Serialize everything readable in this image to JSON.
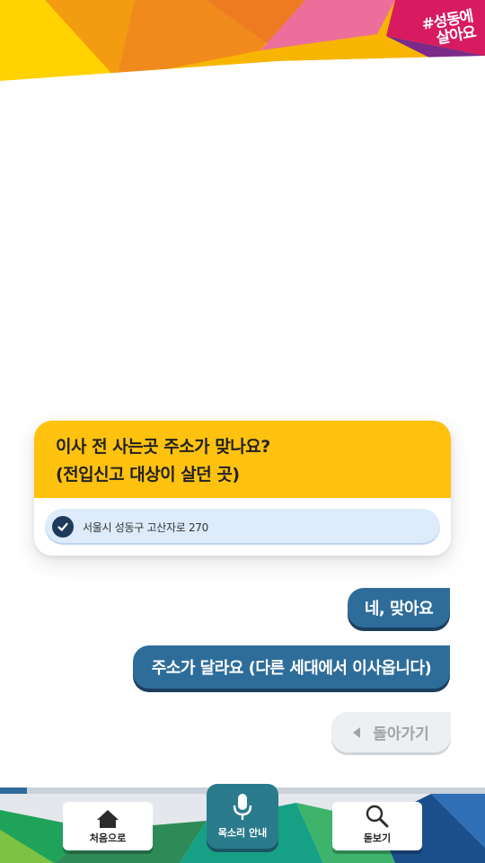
{
  "header": {
    "brand_line1": "#성동에",
    "brand_line2": "살아요"
  },
  "question": {
    "line1": "이사 전 사는곳 주소가 맞나요?",
    "line2": "(전입신고 대상이 살던 곳)",
    "address": "서울시 성동구 고산자로 270",
    "check_icon": "check-icon"
  },
  "answers": {
    "yes_label": "네, 맞아요",
    "no_label": "주소가 달라요 (다른 세대에서 이사옵니다)"
  },
  "back_label": "돌아가기",
  "progress": {
    "fraction": 0.055
  },
  "bottom_nav": {
    "home_label": "처음으로",
    "voice_label": "목소리 안내",
    "look_label": "돋보기"
  },
  "colors": {
    "question_bg": "#FFC20E",
    "answer_bg": "#2E6D9A",
    "voice_bg": "#2A7B8C"
  }
}
